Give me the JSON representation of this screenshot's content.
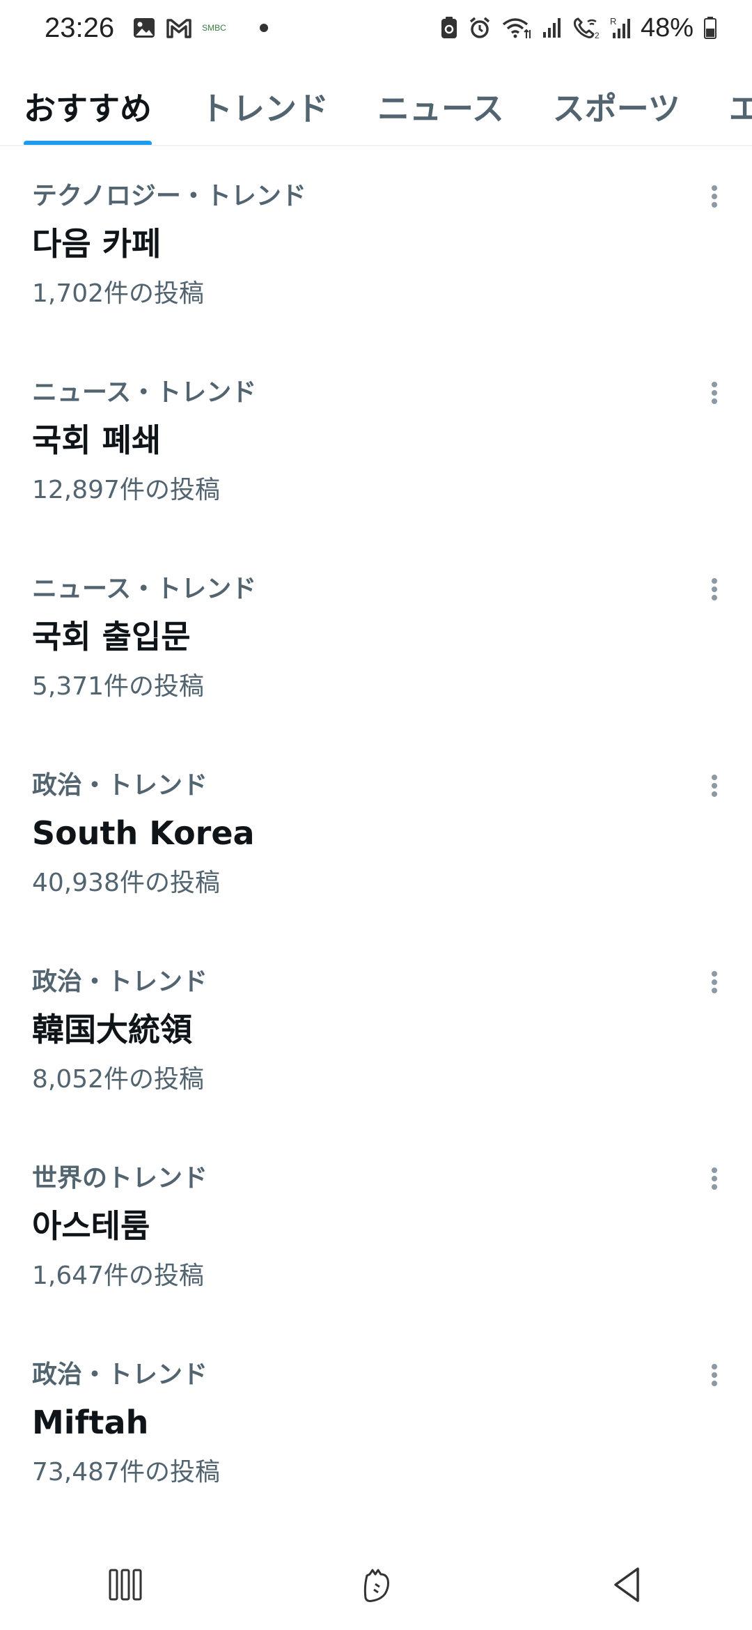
{
  "status_bar": {
    "time": "23:26",
    "battery": "48%",
    "left_icons": [
      "gallery-icon",
      "gmail-icon",
      "smbc-icon"
    ],
    "right_icons": [
      "sync-icon",
      "alarm-icon",
      "wifi-icon",
      "signal-icon",
      "wifi-calling-icon",
      "roaming-signal-icon",
      "battery-icon"
    ],
    "smbc_label": "SMBC"
  },
  "tabs": [
    {
      "label": "おすすめ",
      "active": true
    },
    {
      "label": "トレンド",
      "active": false
    },
    {
      "label": "ニュース",
      "active": false
    },
    {
      "label": "スポーツ",
      "active": false
    },
    {
      "label": "エンターテインメント",
      "active": false
    }
  ],
  "trends": [
    {
      "category": "テクノロジー・トレンド",
      "title": "다음 카페",
      "count": "1,702件の投稿"
    },
    {
      "category": "ニュース・トレンド",
      "title": "국회 폐쇄",
      "count": "12,897件の投稿"
    },
    {
      "category": "ニュース・トレンド",
      "title": "국회 출입문",
      "count": "5,371件の投稿"
    },
    {
      "category": "政治・トレンド",
      "title": "South Korea",
      "count": "40,938件の投稿"
    },
    {
      "category": "政治・トレンド",
      "title": "韓国大統領",
      "count": "8,052件の投稿"
    },
    {
      "category": "世界のトレンド",
      "title": "아스테룸",
      "count": "1,647件の投稿"
    },
    {
      "category": "政治・トレンド",
      "title": "Miftah",
      "count": "73,487件の投稿"
    }
  ],
  "nav_bar": {
    "icons": [
      "recent-apps-icon",
      "home-icon",
      "back-icon"
    ]
  },
  "colors": {
    "accent": "#1d9bf0",
    "secondary_text": "#536471",
    "primary_text": "#0f1419"
  }
}
